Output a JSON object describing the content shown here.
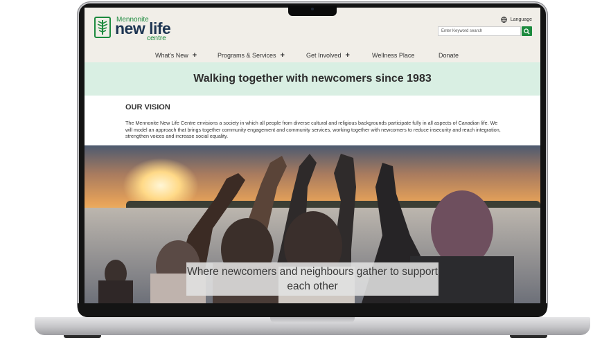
{
  "logo": {
    "small": "Mennonite",
    "big": "new life",
    "sub": "centre"
  },
  "header": {
    "language_label": "Language",
    "search_placeholder": "Enter Keyword search"
  },
  "nav": {
    "items": [
      {
        "label": "What's New",
        "has_submenu": true
      },
      {
        "label": "Programs & Services",
        "has_submenu": true
      },
      {
        "label": "Get Involved",
        "has_submenu": true
      },
      {
        "label": "Wellness Place",
        "has_submenu": false
      },
      {
        "label": "Donate",
        "has_submenu": false
      }
    ],
    "submenu_symbol": "+"
  },
  "tagline": "Walking together with newcomers since 1983",
  "vision": {
    "title": "OUR VISION",
    "body": "The Mennonite New Life Centre envisions a society in which all people from diverse cultural and religious backgrounds participate fully in all aspects of Canadian life. We will model an approach that brings together community engagement and community services, working together with newcomers to reduce insecurity and reach integration, strengthen voices and increase social equality."
  },
  "hero": {
    "caption": "Where newcomers and neighbours gather to support each other"
  },
  "colors": {
    "brand_green": "#1c8a3e",
    "brand_navy": "#1e3552",
    "header_bg": "#f1eee8",
    "band_bg": "#d9efe3"
  }
}
